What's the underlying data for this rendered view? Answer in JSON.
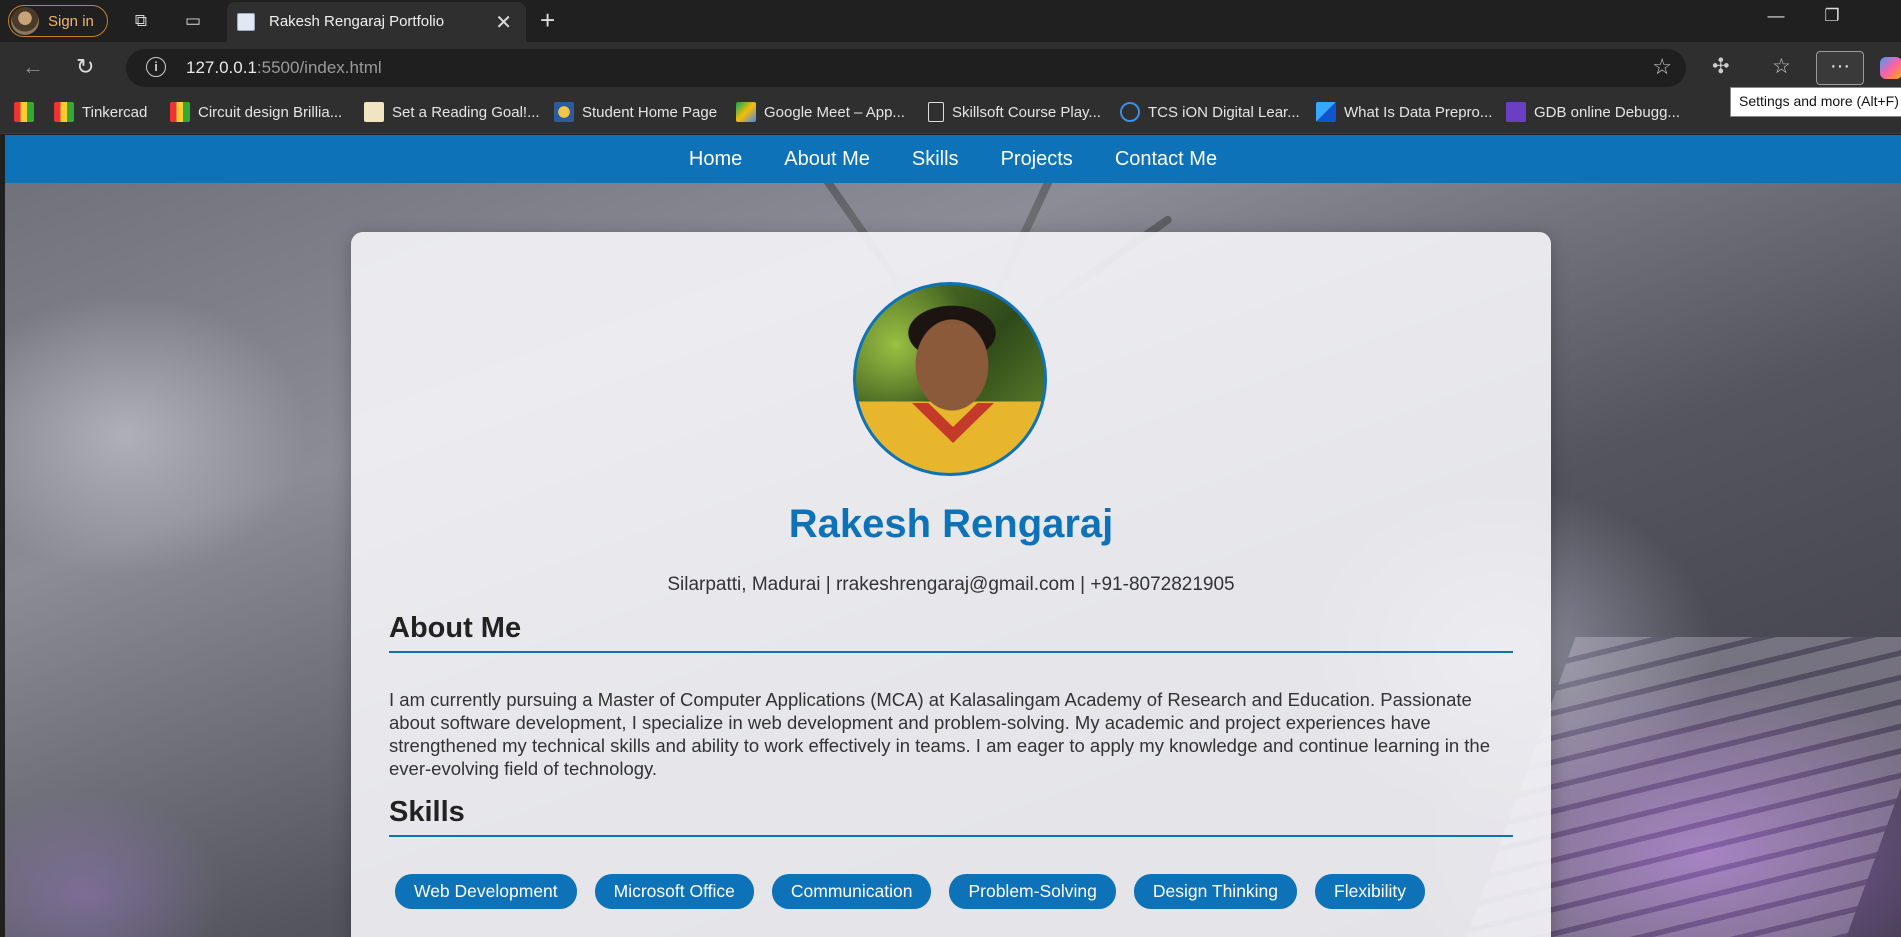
{
  "browser": {
    "signin_label": "Sign in",
    "tab_title": "Rakesh Rengaraj Portfolio",
    "url_host": "127.0.0.1",
    "url_rest": ":5500/index.html",
    "tooltip": "Settings and more (Alt+F)",
    "bookmarks": [
      "",
      "Tinkercad",
      "Circuit design Brillia...",
      "Set a Reading Goal!...",
      "Student Home Page",
      "Google Meet – App...",
      "Skillsoft Course Play...",
      "TCS iON Digital Lear...",
      "What Is Data Prepro...",
      "GDB online Debugg..."
    ]
  },
  "site": {
    "nav": [
      "Home",
      "About Me",
      "Skills",
      "Projects",
      "Contact Me"
    ],
    "name": "Rakesh Rengaraj",
    "contact": "Silarpatti, Madurai | rrakeshrengaraj@gmail.com | +91-8072821905",
    "about_title": "About Me",
    "about_text": "I am currently pursuing a Master of Computer Applications (MCA) at Kalasalingam Academy of Research and Education. Passionate about software development, I specialize in web development and problem-solving. My academic and project experiences have strengthened my technical skills and ability to work effectively in teams. I am eager to apply my knowledge and continue learning in the ever-evolving field of technology.",
    "skills_title": "Skills",
    "skills": [
      "Web Development",
      "Microsoft Office",
      "Communication",
      "Problem-Solving",
      "Design Thinking",
      "Flexibility"
    ]
  },
  "colors": {
    "accent": "#0d72b8",
    "chrome_bg": "#202020",
    "toolbar_bg": "#2f2f2f"
  }
}
